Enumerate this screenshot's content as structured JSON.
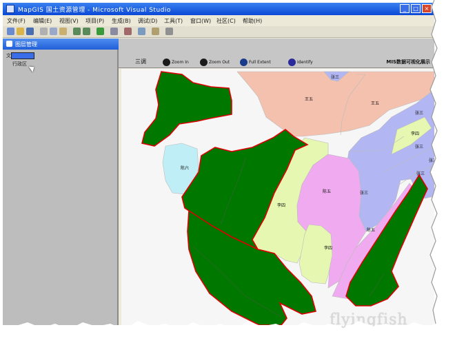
{
  "window": {
    "title": "MapGIS 国土资源管理 - Microsoft Visual Studio"
  },
  "menu": {
    "items": [
      "文件(F)",
      "编辑(E)",
      "视图(V)",
      "项目(P)",
      "生成(B)",
      "调试(D)",
      "工具(T)",
      "窗口(W)",
      "社区(C)",
      "帮助(H)"
    ]
  },
  "sidebar": {
    "title": "图层管理",
    "tree": {
      "root": "文",
      "selected": "",
      "child": "行政区"
    }
  },
  "map_toolbar": {
    "first_label": "三调",
    "buttons": [
      {
        "icon": "zoom-in-icon",
        "label": "Zoom In",
        "color": "#1b1b1b"
      },
      {
        "icon": "zoom-out-icon",
        "label": "Zoom Out",
        "color": "#1b1b1b"
      },
      {
        "icon": "globe-icon",
        "label": "Full Extent",
        "color": "#1a3a8a"
      },
      {
        "icon": "info-icon",
        "label": "Identify",
        "color": "#2a2a9a"
      }
    ],
    "title": "MIS数据可视化展示"
  },
  "map": {
    "colors": {
      "green": "#007800",
      "boundary": "#dd0000",
      "salmon": "#f4c1ae",
      "lavender": "#b2b6f2",
      "lightgreen": "#e5f7b0",
      "pink": "#efaaf0",
      "cyan": "#bfeef6",
      "background": "#f6f6f6"
    },
    "labels": [
      "张三",
      "王五",
      "王五",
      "张三",
      "李四",
      "张三",
      "张三",
      "张三",
      "陈六",
      "李四",
      "陈五",
      "张三",
      "陈五",
      "李四"
    ]
  },
  "watermark": "flyingfish"
}
